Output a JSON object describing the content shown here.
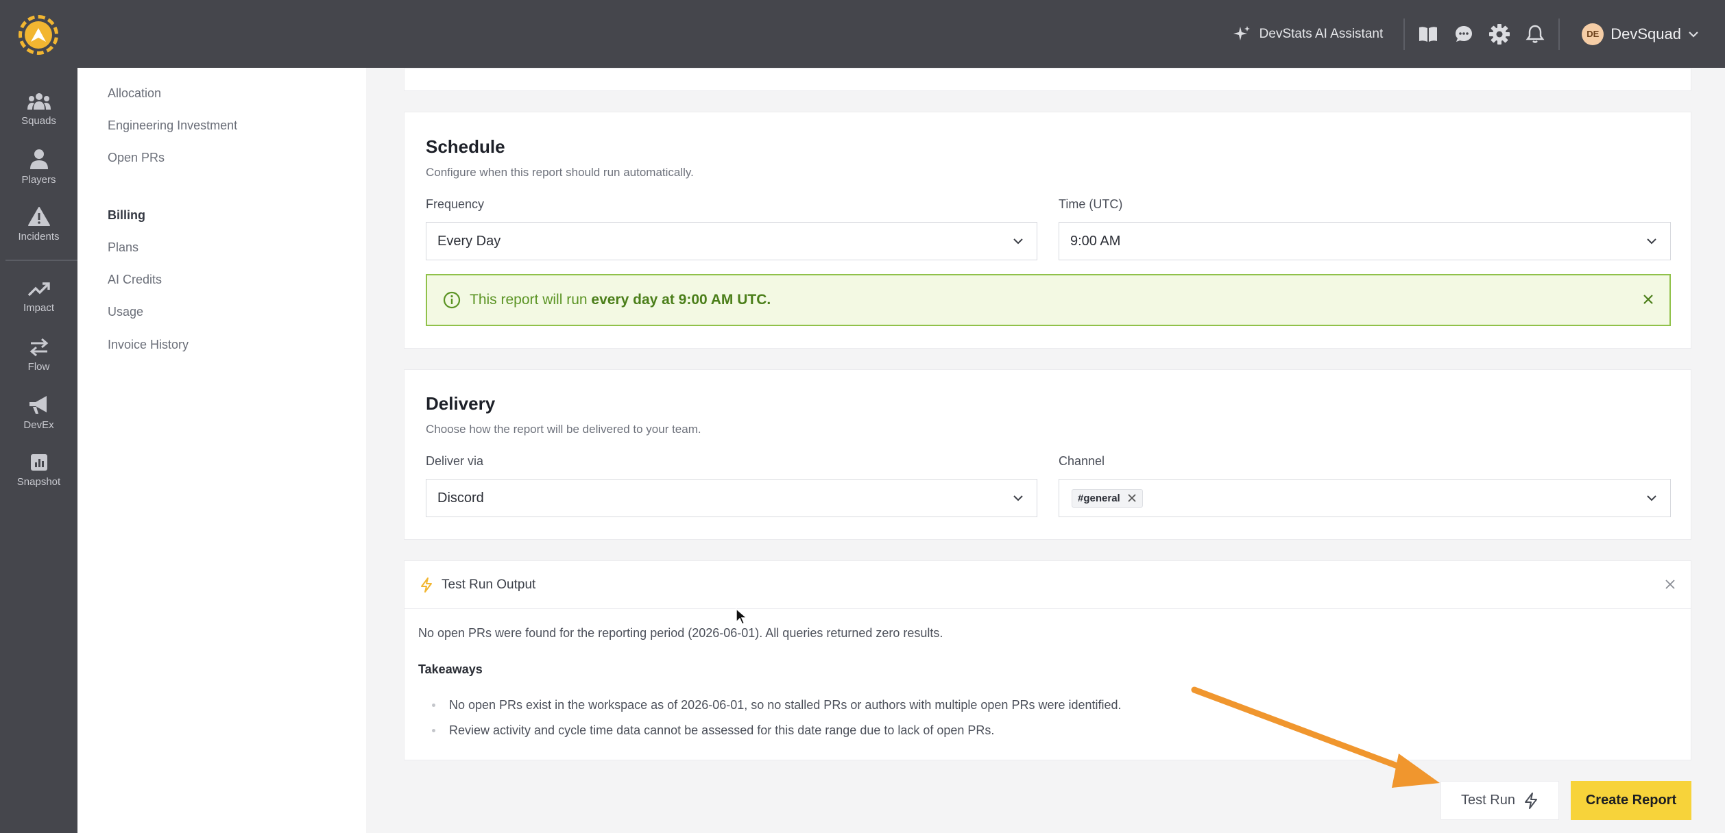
{
  "header": {
    "ai_assistant_label": "DevStats AI Assistant",
    "user_initials": "DE",
    "user_name": "DevSquad"
  },
  "rail": {
    "items": [
      {
        "label": "Squads",
        "icon": "squads-icon"
      },
      {
        "label": "Players",
        "icon": "players-icon"
      },
      {
        "label": "Incidents",
        "icon": "incidents-icon"
      },
      {
        "label": "Impact",
        "icon": "impact-icon"
      },
      {
        "label": "Flow",
        "icon": "flow-icon"
      },
      {
        "label": "DevEx",
        "icon": "megaphone-icon"
      },
      {
        "label": "Snapshot",
        "icon": "snapshot-icon"
      }
    ]
  },
  "subnav": {
    "items": [
      "Allocation",
      "Engineering Investment",
      "Open PRs"
    ],
    "billing_heading": "Billing",
    "billing_items": [
      "Plans",
      "AI Credits",
      "Usage",
      "Invoice History"
    ]
  },
  "schedule": {
    "title": "Schedule",
    "subtitle": "Configure when this report should run automatically.",
    "frequency_label": "Frequency",
    "frequency_value": "Every Day",
    "time_label": "Time (UTC)",
    "time_value": "9:00 AM",
    "banner_prefix": "This report will run ",
    "banner_bold": "every day at 9:00 AM UTC."
  },
  "delivery": {
    "title": "Delivery",
    "subtitle": "Choose how the report will be delivered to your team.",
    "deliver_label": "Deliver via",
    "deliver_value": "Discord",
    "channel_label": "Channel",
    "channel_tag": "#general"
  },
  "output": {
    "title": "Test Run Output",
    "summary": "No open PRs were found for the reporting period (2026-06-01). All queries returned zero results.",
    "takeaways_heading": "Takeaways",
    "takeaways": [
      "No open PRs exist in the workspace as of 2026-06-01, so no stalled PRs or authors with multiple open PRs were identified.",
      "Review activity and cycle time data cannot be assessed for this date range due to lack of open PRs."
    ]
  },
  "actions": {
    "test_run_label": "Test Run",
    "create_label": "Create Report"
  },
  "colors": {
    "accent": "#f7d33a",
    "annotation_arrow": "#f0962e",
    "success": "#5b9424"
  }
}
